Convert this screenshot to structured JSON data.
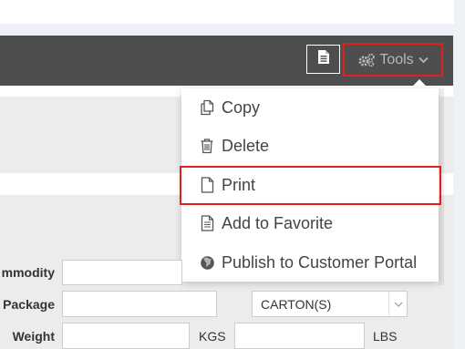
{
  "toolbar": {
    "document_button_icon": "document-icon",
    "tools_label": "Tools",
    "tools_icon": "gears-icon",
    "tools_caret_icon": "chevron-down-icon"
  },
  "tools_menu": {
    "items": [
      {
        "label": "Copy",
        "icon": "copy-icon"
      },
      {
        "label": "Delete",
        "icon": "trash-icon"
      },
      {
        "label": "Print",
        "icon": "file-icon"
      },
      {
        "label": "Add to Favorite",
        "icon": "document-list-icon"
      },
      {
        "label": "Publish to Customer Portal",
        "icon": "globe-icon"
      }
    ]
  },
  "form": {
    "commodity_label": "mmodity",
    "package_label": "Package",
    "package_unit_value": "CARTON(S)",
    "weight_label": "Weight",
    "weight_unit_kgs": "KGS",
    "weight_unit_lbs": "LBS"
  },
  "colors": {
    "header_bar": "#4e4e4e",
    "highlight": "#e02020",
    "panel": "#ebebeb"
  }
}
